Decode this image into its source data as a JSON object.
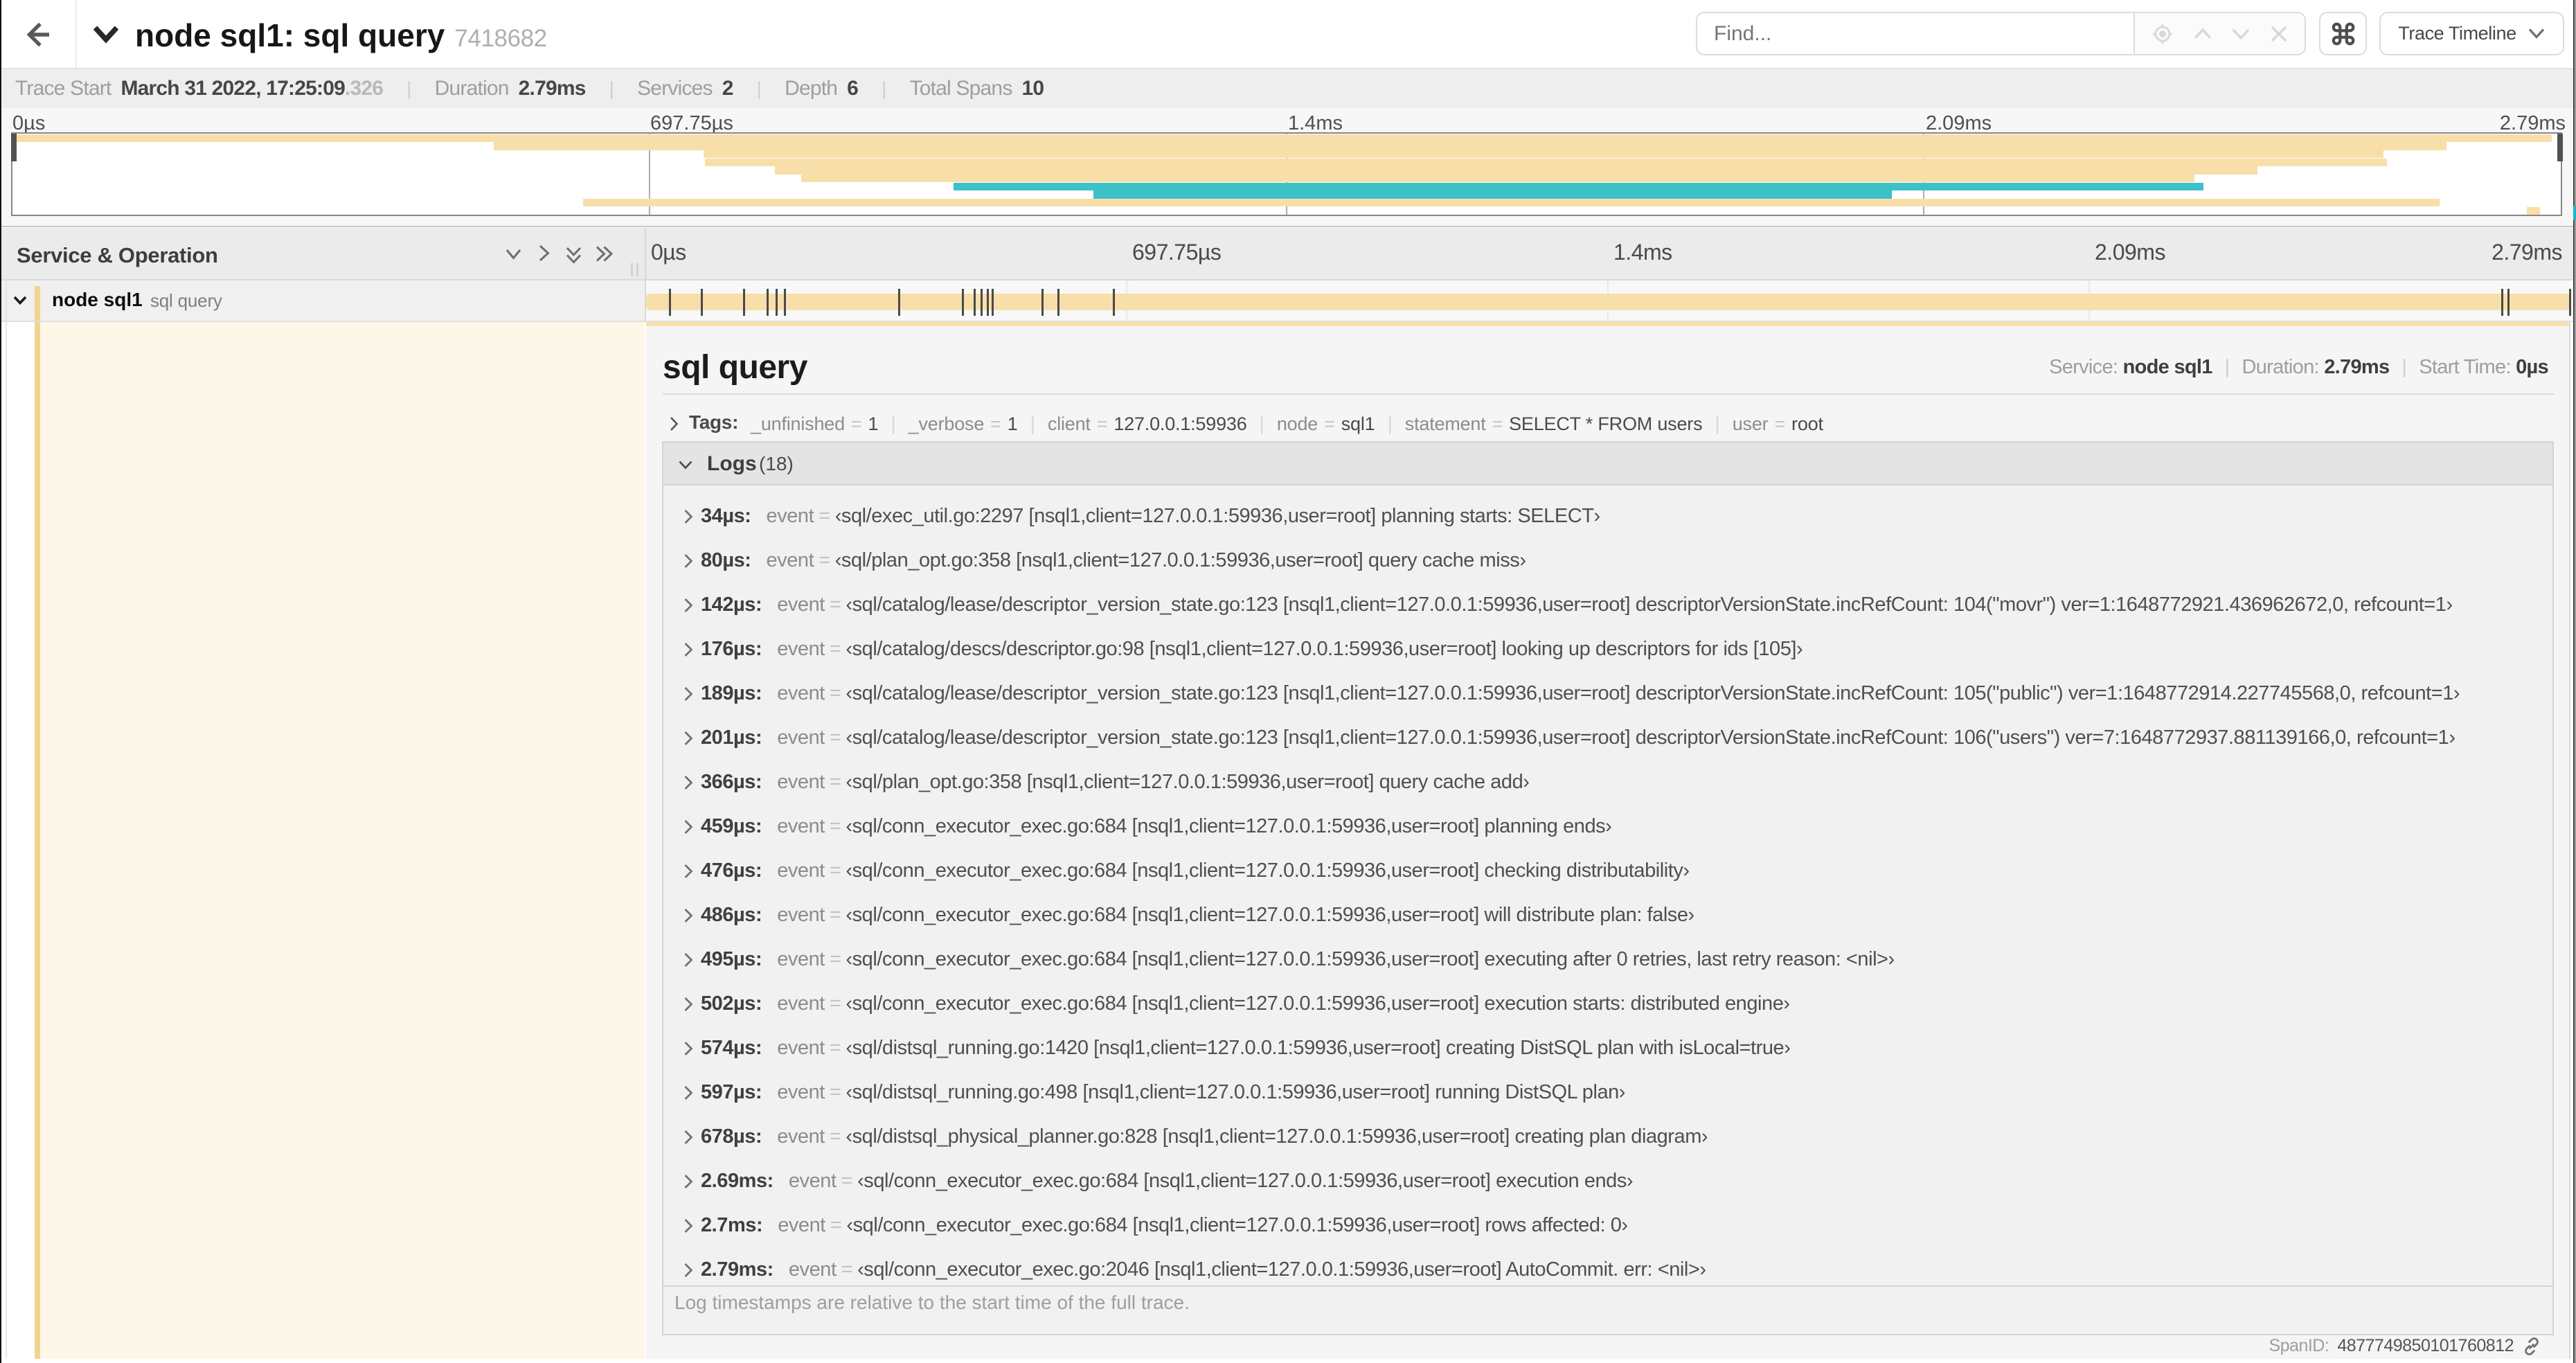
{
  "colors": {
    "tan": "#F8DFAA",
    "teal": "#3BC1C7",
    "accent_strip": "#F2D391",
    "detail_cream": "#FDF7EA"
  },
  "header": {
    "back_icon": "arrow-left",
    "title_chevron_icon": "chevron-down",
    "title": "node sql1: sql query",
    "trace_id": "7418682",
    "find": {
      "placeholder": "Find...",
      "icons": [
        "locate",
        "chevron-up",
        "chevron-down",
        "close"
      ]
    },
    "shortcut_button": "command-icon",
    "view_dropdown": {
      "label": "Trace Timeline",
      "icon": "chevron-down"
    }
  },
  "summary": {
    "items": [
      {
        "label": "Trace Start",
        "value": "March 31 2022, 17:25:09",
        "suffix": ".326"
      },
      {
        "label": "Duration",
        "value": "2.79ms"
      },
      {
        "label": "Services",
        "value": "2"
      },
      {
        "label": "Depth",
        "value": "6"
      },
      {
        "label": "Total Spans",
        "value": "10"
      }
    ]
  },
  "minimap": {
    "ruler_labels": [
      "0µs",
      "697.75µs",
      "1.4ms",
      "2.09ms",
      "2.79ms"
    ],
    "spans": [
      {
        "start": 0.0,
        "end": 0.9966,
        "color": "tan"
      },
      {
        "start": 0.1888,
        "end": 0.9551,
        "color": "tan"
      },
      {
        "start": 0.2712,
        "end": 0.9304,
        "color": "tan"
      },
      {
        "start": 0.2717,
        "end": 0.9318,
        "color": "tan"
      },
      {
        "start": 0.2991,
        "end": 0.8811,
        "color": "tan"
      },
      {
        "start": 0.3094,
        "end": 0.8562,
        "color": "tan"
      },
      {
        "start": 0.3693,
        "end": 0.8597,
        "color": "teal"
      },
      {
        "start": 0.4243,
        "end": 0.7375,
        "color": "teal"
      },
      {
        "start": 0.224,
        "end": 0.9524,
        "color": "tan"
      },
      {
        "start": 0.9868,
        "end": 0.9919,
        "color": "tan"
      }
    ]
  },
  "timeline": {
    "header_title": "Service & Operation",
    "header_icons": [
      "chevron-down",
      "chevron-right",
      "double-chevron-down",
      "double-chevron-right"
    ],
    "ruler_labels": [
      "0µs",
      "697.75µs",
      "1.4ms",
      "2.09ms",
      "2.79ms"
    ],
    "span_row": {
      "service": "node sql1",
      "operation": "sql query",
      "bar_color": "tan",
      "log_ticks": [
        0.0122,
        0.0287,
        0.0509,
        0.0631,
        0.0677,
        0.072,
        0.1312,
        0.1645,
        0.1706,
        0.1742,
        0.1774,
        0.1799,
        0.2057,
        0.214,
        0.243,
        0.9642,
        0.9677,
        0.9995
      ]
    }
  },
  "detail": {
    "title": "sql query",
    "meta": [
      {
        "label": "Service:",
        "value": "node sql1"
      },
      {
        "label": "Duration:",
        "value": "2.79ms"
      },
      {
        "label": "Start Time:",
        "value": "0µs"
      }
    ],
    "tags_label": "Tags:",
    "tags": [
      {
        "key": "_unfinished",
        "value": "1"
      },
      {
        "key": "_verbose",
        "value": "1"
      },
      {
        "key": "client",
        "value": "127.0.0.1:59936"
      },
      {
        "key": "node",
        "value": "sql1"
      },
      {
        "key": "statement",
        "value": "SELECT * FROM users"
      },
      {
        "key": "user",
        "value": "root"
      }
    ],
    "logs_label": "Logs",
    "logs_count": "(18)",
    "log_field_key": "event",
    "logs": [
      {
        "ts": "34µs:",
        "value": "‹sql/exec_util.go:2297 [nsql1,client=127.0.0.1:59936,user=root] planning starts: SELECT›"
      },
      {
        "ts": "80µs:",
        "value": "‹sql/plan_opt.go:358 [nsql1,client=127.0.0.1:59936,user=root] query cache miss›"
      },
      {
        "ts": "142µs:",
        "value": "‹sql/catalog/lease/descriptor_version_state.go:123 [nsql1,client=127.0.0.1:59936,user=root] descriptorVersionState.incRefCount: 104(\"movr\") ver=1:1648772921.436962672,0, refcount=1›"
      },
      {
        "ts": "176µs:",
        "value": "‹sql/catalog/descs/descriptor.go:98 [nsql1,client=127.0.0.1:59936,user=root] looking up descriptors for ids [105]›"
      },
      {
        "ts": "189µs:",
        "value": "‹sql/catalog/lease/descriptor_version_state.go:123 [nsql1,client=127.0.0.1:59936,user=root] descriptorVersionState.incRefCount: 105(\"public\") ver=1:1648772914.227745568,0, refcount=1›"
      },
      {
        "ts": "201µs:",
        "value": "‹sql/catalog/lease/descriptor_version_state.go:123 [nsql1,client=127.0.0.1:59936,user=root] descriptorVersionState.incRefCount: 106(\"users\") ver=7:1648772937.881139166,0, refcount=1›"
      },
      {
        "ts": "366µs:",
        "value": "‹sql/plan_opt.go:358 [nsql1,client=127.0.0.1:59936,user=root] query cache add›"
      },
      {
        "ts": "459µs:",
        "value": "‹sql/conn_executor_exec.go:684 [nsql1,client=127.0.0.1:59936,user=root] planning ends›"
      },
      {
        "ts": "476µs:",
        "value": "‹sql/conn_executor_exec.go:684 [nsql1,client=127.0.0.1:59936,user=root] checking distributability›"
      },
      {
        "ts": "486µs:",
        "value": "‹sql/conn_executor_exec.go:684 [nsql1,client=127.0.0.1:59936,user=root] will distribute plan: false›"
      },
      {
        "ts": "495µs:",
        "value": "‹sql/conn_executor_exec.go:684 [nsql1,client=127.0.0.1:59936,user=root] executing after 0 retries, last retry reason: <nil>›"
      },
      {
        "ts": "502µs:",
        "value": "‹sql/conn_executor_exec.go:684 [nsql1,client=127.0.0.1:59936,user=root] execution starts: distributed engine›"
      },
      {
        "ts": "574µs:",
        "value": "‹sql/distsql_running.go:1420 [nsql1,client=127.0.0.1:59936,user=root] creating DistSQL plan with isLocal=true›"
      },
      {
        "ts": "597µs:",
        "value": "‹sql/distsql_running.go:498 [nsql1,client=127.0.0.1:59936,user=root] running DistSQL plan›"
      },
      {
        "ts": "678µs:",
        "value": "‹sql/distsql_physical_planner.go:828 [nsql1,client=127.0.0.1:59936,user=root] creating plan diagram›"
      },
      {
        "ts": "2.69ms:",
        "value": "‹sql/conn_executor_exec.go:684 [nsql1,client=127.0.0.1:59936,user=root] execution ends›"
      },
      {
        "ts": "2.7ms:",
        "value": "‹sql/conn_executor_exec.go:684 [nsql1,client=127.0.0.1:59936,user=root] rows affected: 0›"
      },
      {
        "ts": "2.79ms:",
        "value": "‹sql/conn_executor_exec.go:2046 [nsql1,client=127.0.0.1:59936,user=root] AutoCommit. err: <nil>›"
      }
    ],
    "logs_note": "Log timestamps are relative to the start time of the full trace.",
    "span_id_label": "SpanID:",
    "span_id": "4877749850101760812"
  }
}
